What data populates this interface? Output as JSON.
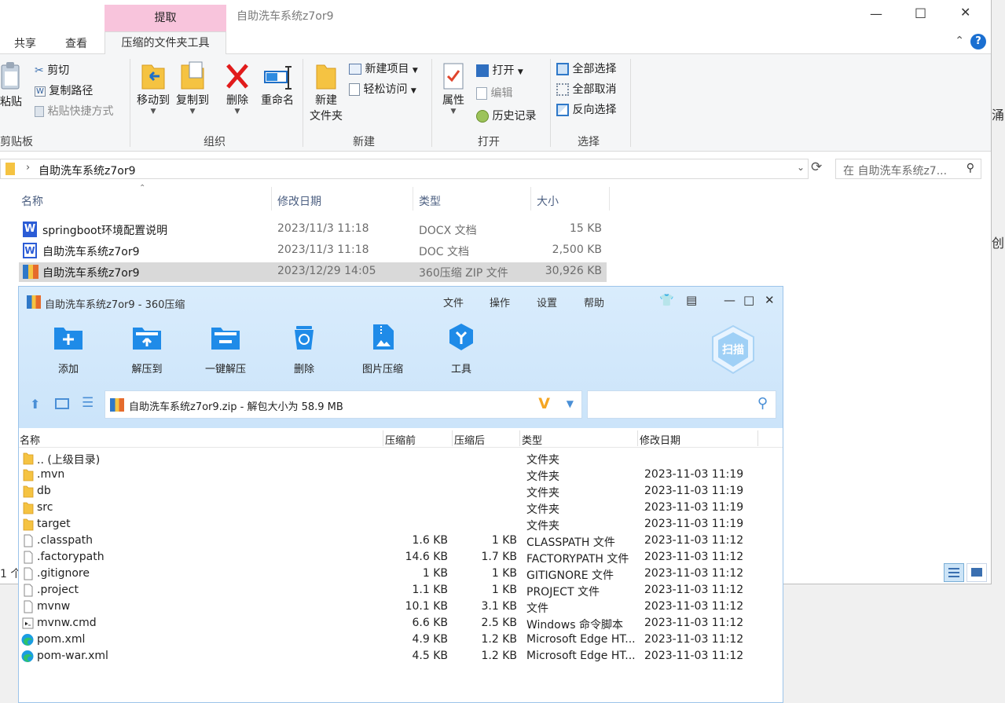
{
  "explorer": {
    "title": "自助洗车系统z7or9",
    "context_tab": "提取",
    "tabs": [
      "共享",
      "查看"
    ],
    "active_tab": "压缩的文件夹工具",
    "ribbon": {
      "clipboard": {
        "paste": "粘贴",
        "cut": "剪切",
        "copy_path": "复制路径",
        "paste_shortcut": "粘贴快捷方式",
        "label": "剪贴板"
      },
      "organize": {
        "move_to": "移动到",
        "copy_to": "复制到",
        "delete": "删除",
        "rename": "重命名",
        "label": "组织"
      },
      "new": {
        "new_folder_line1": "新建",
        "new_folder_line2": "文件夹",
        "new_item": "新建项目",
        "easy_access": "轻松访问",
        "label": "新建"
      },
      "open": {
        "properties": "属性",
        "open": "打开",
        "edit": "编辑",
        "history": "历史记录",
        "label": "打开"
      },
      "select": {
        "select_all": "全部选择",
        "select_none": "全部取消",
        "invert": "反向选择",
        "label": "选择"
      }
    },
    "address": "自助洗车系统z7or9",
    "search_placeholder": "在 自助洗车系统z7...",
    "columns": [
      "名称",
      "修改日期",
      "类型",
      "大小"
    ],
    "files": [
      {
        "name": "springboot环境配置说明",
        "date": "2023/11/3 11:18",
        "type": "DOCX 文档",
        "size": "15 KB",
        "icon": "wps-word-icon"
      },
      {
        "name": "自助洗车系统z7or9",
        "date": "2023/11/3 11:18",
        "type": "DOC 文档",
        "size": "2,500 KB",
        "icon": "word-doc-icon"
      },
      {
        "name": "自助洗车系统z7or9",
        "date": "2023/12/29 14:05",
        "type": "360压缩 ZIP 文件",
        "size": "30,926 KB",
        "icon": "zip-archive-icon"
      }
    ],
    "status": "1 个",
    "peek_chars": [
      "涌",
      "创"
    ]
  },
  "zip": {
    "title": "自助洗车系统z7or9 - 360压缩",
    "menu": [
      "文件",
      "操作",
      "设置",
      "帮助"
    ],
    "tools": [
      {
        "label": "添加",
        "icon": "add-folder-icon"
      },
      {
        "label": "解压到",
        "icon": "extract-to-icon"
      },
      {
        "label": "一键解压",
        "icon": "one-click-extract-icon"
      },
      {
        "label": "删除",
        "icon": "recycle-bin-icon"
      },
      {
        "label": "图片压缩",
        "icon": "image-compress-icon"
      },
      {
        "label": "工具",
        "icon": "tools-icon"
      }
    ],
    "scan_label": "扫描",
    "path_text": "自助洗车系统z7or9.zip - 解包大小为 58.9 MB",
    "columns": [
      "名称",
      "压缩前",
      "压缩后",
      "类型",
      "修改日期"
    ],
    "rows": [
      {
        "name": ".. (上级目录)",
        "before": "",
        "after": "",
        "type": "文件夹",
        "date": "",
        "icon": "folder"
      },
      {
        "name": ".mvn",
        "before": "",
        "after": "",
        "type": "文件夹",
        "date": "2023-11-03 11:19",
        "icon": "folder"
      },
      {
        "name": "db",
        "before": "",
        "after": "",
        "type": "文件夹",
        "date": "2023-11-03 11:19",
        "icon": "folder"
      },
      {
        "name": "src",
        "before": "",
        "after": "",
        "type": "文件夹",
        "date": "2023-11-03 11:19",
        "icon": "folder"
      },
      {
        "name": "target",
        "before": "",
        "after": "",
        "type": "文件夹",
        "date": "2023-11-03 11:19",
        "icon": "folder"
      },
      {
        "name": ".classpath",
        "before": "1.6 KB",
        "after": "1 KB",
        "type": "CLASSPATH 文件",
        "date": "2023-11-03 11:12",
        "icon": "file"
      },
      {
        "name": ".factorypath",
        "before": "14.6 KB",
        "after": "1.7 KB",
        "type": "FACTORYPATH 文件",
        "date": "2023-11-03 11:12",
        "icon": "file"
      },
      {
        "name": ".gitignore",
        "before": "1 KB",
        "after": "1 KB",
        "type": "GITIGNORE 文件",
        "date": "2023-11-03 11:12",
        "icon": "file"
      },
      {
        "name": ".project",
        "before": "1.1 KB",
        "after": "1 KB",
        "type": "PROJECT 文件",
        "date": "2023-11-03 11:12",
        "icon": "file"
      },
      {
        "name": "mvnw",
        "before": "10.1 KB",
        "after": "3.1 KB",
        "type": "文件",
        "date": "2023-11-03 11:12",
        "icon": "file"
      },
      {
        "name": "mvnw.cmd",
        "before": "6.6 KB",
        "after": "2.5 KB",
        "type": "Windows 命令脚本",
        "date": "2023-11-03 11:12",
        "icon": "cmd"
      },
      {
        "name": "pom.xml",
        "before": "4.9 KB",
        "after": "1.2 KB",
        "type": "Microsoft Edge HT...",
        "date": "2023-11-03 11:12",
        "icon": "edge"
      },
      {
        "name": "pom-war.xml",
        "before": "4.5 KB",
        "after": "1.2 KB",
        "type": "Microsoft Edge HT...",
        "date": "2023-11-03 11:12",
        "icon": "edge"
      }
    ]
  }
}
